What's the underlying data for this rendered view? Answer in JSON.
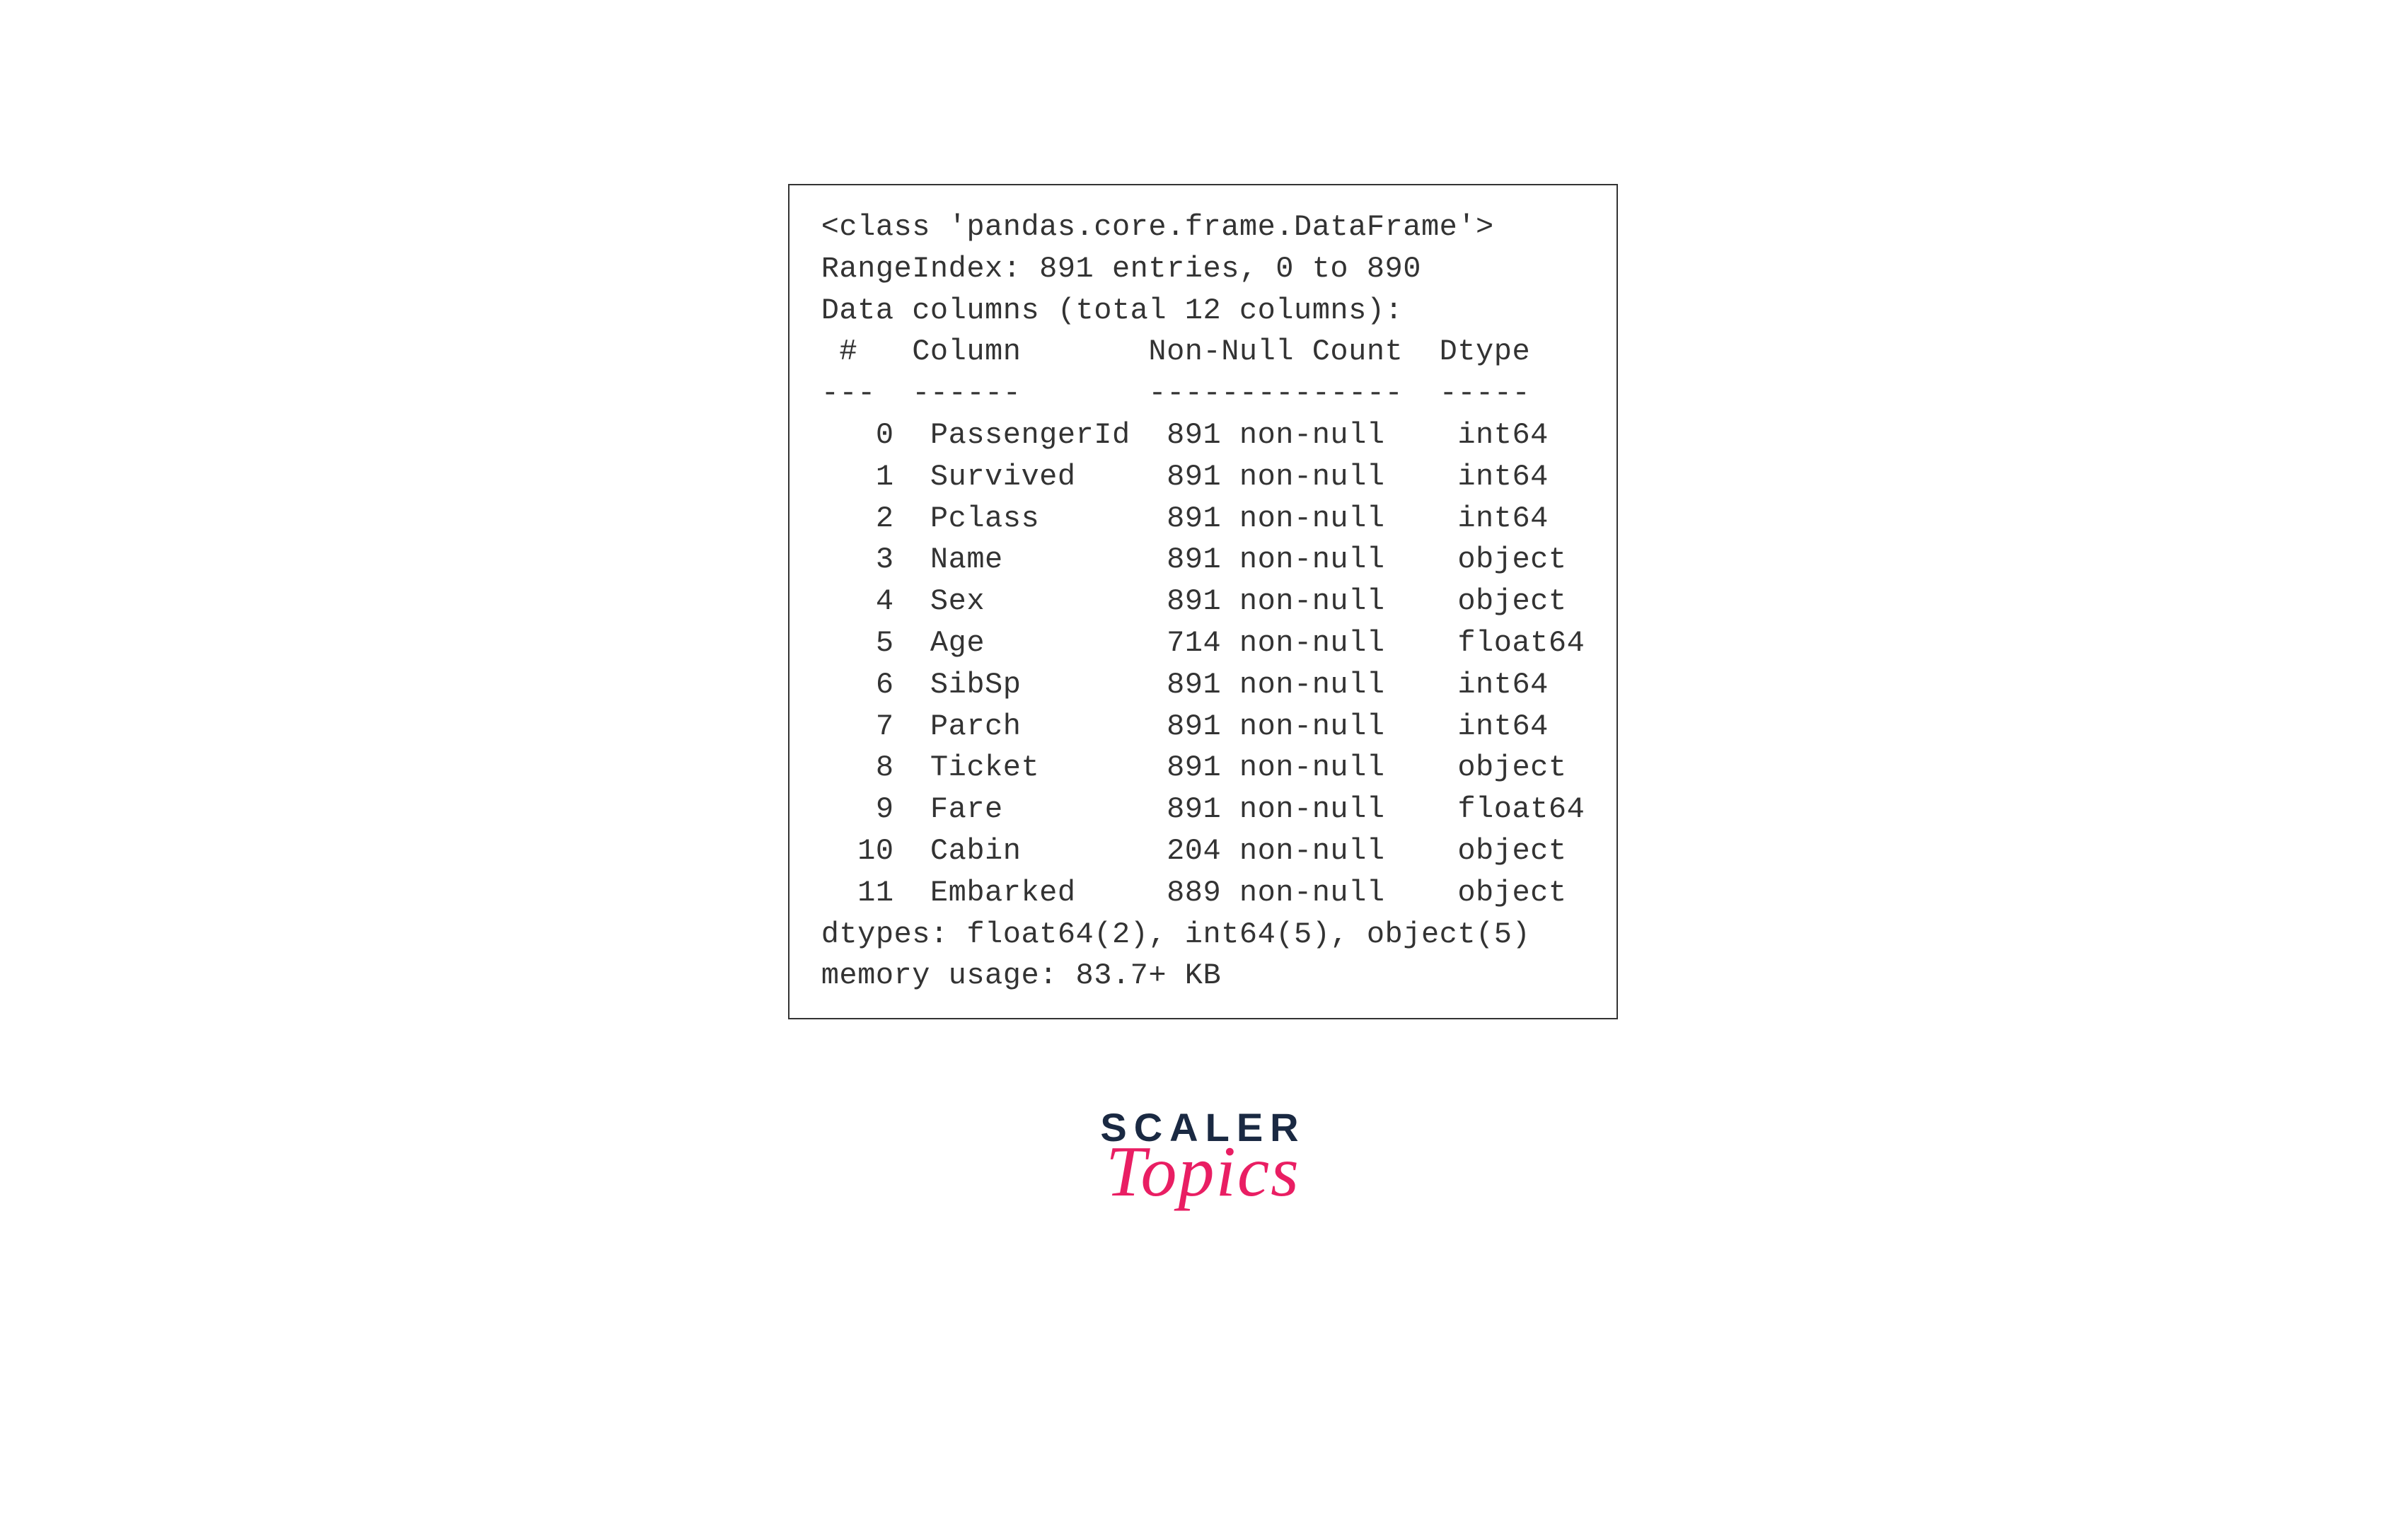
{
  "output": {
    "class_line": "<class 'pandas.core.frame.DataFrame'>",
    "range_index": "RangeIndex: 891 entries, 0 to 890",
    "data_columns_header": "Data columns (total 12 columns):",
    "header_row": " #   Column       Non-Null Count  Dtype  ",
    "separator_row": "---  ------       --------------  -----  ",
    "columns": [
      {
        "index": 0,
        "name": "PassengerId",
        "non_null": "891 non-null",
        "dtype": "int64"
      },
      {
        "index": 1,
        "name": "Survived",
        "non_null": "891 non-null",
        "dtype": "int64"
      },
      {
        "index": 2,
        "name": "Pclass",
        "non_null": "891 non-null",
        "dtype": "int64"
      },
      {
        "index": 3,
        "name": "Name",
        "non_null": "891 non-null",
        "dtype": "object"
      },
      {
        "index": 4,
        "name": "Sex",
        "non_null": "891 non-null",
        "dtype": "object"
      },
      {
        "index": 5,
        "name": "Age",
        "non_null": "714 non-null",
        "dtype": "float64"
      },
      {
        "index": 6,
        "name": "SibSp",
        "non_null": "891 non-null",
        "dtype": "int64"
      },
      {
        "index": 7,
        "name": "Parch",
        "non_null": "891 non-null",
        "dtype": "int64"
      },
      {
        "index": 8,
        "name": "Ticket",
        "non_null": "891 non-null",
        "dtype": "object"
      },
      {
        "index": 9,
        "name": "Fare",
        "non_null": "891 non-null",
        "dtype": "float64"
      },
      {
        "index": 10,
        "name": "Cabin",
        "non_null": "204 non-null",
        "dtype": "object"
      },
      {
        "index": 11,
        "name": "Embarked",
        "non_null": "889 non-null",
        "dtype": "object"
      }
    ],
    "dtypes_summary": "dtypes: float64(2), int64(5), object(5)",
    "memory_usage": "memory usage: 83.7+ KB"
  },
  "logo": {
    "main": "SCALER",
    "sub": "Topics"
  }
}
